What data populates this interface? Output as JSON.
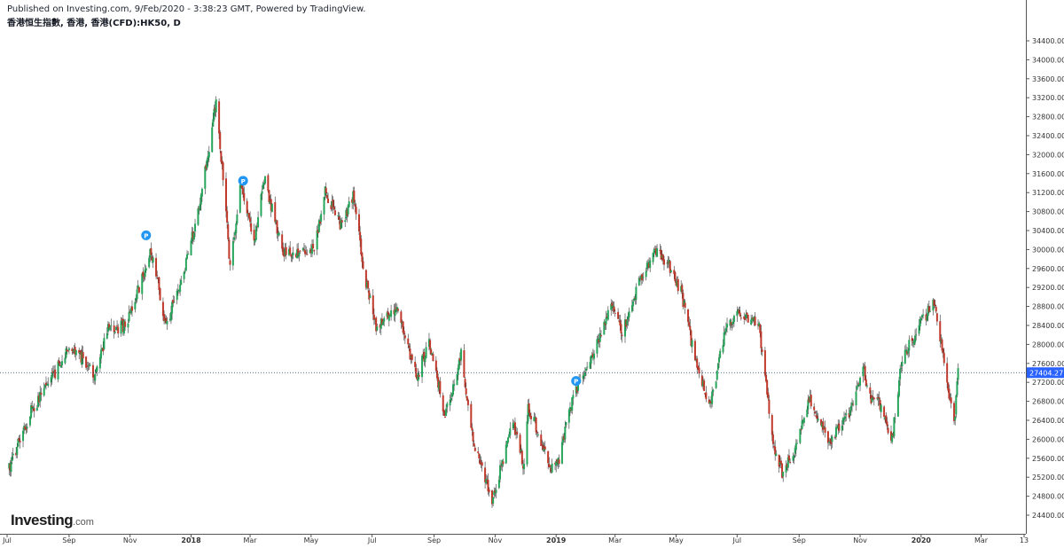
{
  "header": {
    "published": "Published on Investing.com, 9/Feb/2020 - 3:38:23 GMT, Powered by TradingView.",
    "symbol": "香港恒生指數, 香港, 香港(CFD):HK50, D"
  },
  "brand": {
    "name": "Investing",
    "suffix": ".com"
  },
  "colors": {
    "up": "#26a65b",
    "down": "#c0392b",
    "wick": "#333333",
    "current_price_bg": "#2962ff",
    "marker": "#2196f3"
  },
  "chart_data": {
    "type": "candlestick",
    "grid": false,
    "y_range": [
      24200,
      34600
    ],
    "y_ticks": [
      "34400.00",
      "34000.00",
      "33600.00",
      "33200.00",
      "32800.00",
      "32400.00",
      "32000.00",
      "31600.00",
      "31200.00",
      "30800.00",
      "30400.00",
      "30000.00",
      "29600.00",
      "29200.00",
      "28800.00",
      "28400.00",
      "28000.00",
      "27600.00",
      "27200.00",
      "26800.00",
      "26400.00",
      "26000.00",
      "25600.00",
      "25200.00",
      "24800.00",
      "24400.00"
    ],
    "x_ticks": [
      {
        "label": "Jul",
        "date": "2017-07-01"
      },
      {
        "label": "Sep",
        "date": "2017-09-01"
      },
      {
        "label": "Nov",
        "date": "2017-11-01"
      },
      {
        "label": "2018",
        "date": "2018-01-01",
        "bold": true
      },
      {
        "label": "Mar",
        "date": "2018-03-01"
      },
      {
        "label": "May",
        "date": "2018-05-01"
      },
      {
        "label": "Jul",
        "date": "2018-07-01"
      },
      {
        "label": "Sep",
        "date": "2018-09-01"
      },
      {
        "label": "Nov",
        "date": "2018-11-01"
      },
      {
        "label": "2019",
        "date": "2019-01-01",
        "bold": true
      },
      {
        "label": "Mar",
        "date": "2019-03-01"
      },
      {
        "label": "May",
        "date": "2019-05-01"
      },
      {
        "label": "Jul",
        "date": "2019-07-01"
      },
      {
        "label": "Sep",
        "date": "2019-09-01"
      },
      {
        "label": "Nov",
        "date": "2019-11-01"
      },
      {
        "label": "2020",
        "date": "2020-01-01",
        "bold": true
      },
      {
        "label": "Mar",
        "date": "2020-03-01"
      },
      {
        "label": "13",
        "date": "2020-04-13"
      }
    ],
    "current_price": 27404.27,
    "current_price_label": "27404.27",
    "anchors": [
      {
        "date": "2017-07-03",
        "close": 25400
      },
      {
        "date": "2017-07-25",
        "close": 26600
      },
      {
        "date": "2017-08-10",
        "close": 27100
      },
      {
        "date": "2017-08-31",
        "close": 27900
      },
      {
        "date": "2017-09-15",
        "close": 27700
      },
      {
        "date": "2017-09-26",
        "close": 27400
      },
      {
        "date": "2017-10-10",
        "close": 28300
      },
      {
        "date": "2017-10-27",
        "close": 28400
      },
      {
        "date": "2017-11-10",
        "close": 29200
      },
      {
        "date": "2017-11-22",
        "close": 30000
      },
      {
        "date": "2017-12-07",
        "close": 28400
      },
      {
        "date": "2017-12-27",
        "close": 29700
      },
      {
        "date": "2018-01-10",
        "close": 31000
      },
      {
        "date": "2018-01-26",
        "close": 33100
      },
      {
        "date": "2018-02-06",
        "close": 30600
      },
      {
        "date": "2018-02-09",
        "close": 29600
      },
      {
        "date": "2018-02-20",
        "close": 31400
      },
      {
        "date": "2018-03-05",
        "close": 30100
      },
      {
        "date": "2018-03-15",
        "close": 31500
      },
      {
        "date": "2018-04-04",
        "close": 29900
      },
      {
        "date": "2018-05-04",
        "close": 30000
      },
      {
        "date": "2018-05-15",
        "close": 31200
      },
      {
        "date": "2018-05-31",
        "close": 30500
      },
      {
        "date": "2018-06-12",
        "close": 31100
      },
      {
        "date": "2018-06-25",
        "close": 29300
      },
      {
        "date": "2018-07-05",
        "close": 28300
      },
      {
        "date": "2018-07-25",
        "close": 28800
      },
      {
        "date": "2018-08-15",
        "close": 27300
      },
      {
        "date": "2018-08-27",
        "close": 28100
      },
      {
        "date": "2018-09-12",
        "close": 26500
      },
      {
        "date": "2018-09-28",
        "close": 27800
      },
      {
        "date": "2018-10-11",
        "close": 25900
      },
      {
        "date": "2018-10-30",
        "close": 24700
      },
      {
        "date": "2018-11-09",
        "close": 25600
      },
      {
        "date": "2018-11-19",
        "close": 26400
      },
      {
        "date": "2018-11-30",
        "close": 25400
      },
      {
        "date": "2018-12-04",
        "close": 26700
      },
      {
        "date": "2018-12-20",
        "close": 25800
      },
      {
        "date": "2018-12-27",
        "close": 25400
      },
      {
        "date": "2019-01-04",
        "close": 25600
      },
      {
        "date": "2019-01-18",
        "close": 26900
      },
      {
        "date": "2019-02-08",
        "close": 27900
      },
      {
        "date": "2019-02-26",
        "close": 28800
      },
      {
        "date": "2019-03-08",
        "close": 28200
      },
      {
        "date": "2019-03-21",
        "close": 29100
      },
      {
        "date": "2019-04-10",
        "close": 30000
      },
      {
        "date": "2019-04-26",
        "close": 29600
      },
      {
        "date": "2019-05-06",
        "close": 29100
      },
      {
        "date": "2019-05-20",
        "close": 27700
      },
      {
        "date": "2019-06-04",
        "close": 26700
      },
      {
        "date": "2019-06-20",
        "close": 28400
      },
      {
        "date": "2019-07-04",
        "close": 28700
      },
      {
        "date": "2019-07-23",
        "close": 28400
      },
      {
        "date": "2019-08-06",
        "close": 25900
      },
      {
        "date": "2019-08-15",
        "close": 25300
      },
      {
        "date": "2019-08-26",
        "close": 25700
      },
      {
        "date": "2019-09-11",
        "close": 26900
      },
      {
        "date": "2019-10-02",
        "close": 25900
      },
      {
        "date": "2019-10-11",
        "close": 26300
      },
      {
        "date": "2019-10-25",
        "close": 26700
      },
      {
        "date": "2019-11-04",
        "close": 27500
      },
      {
        "date": "2019-11-12",
        "close": 26800
      },
      {
        "date": "2019-11-20",
        "close": 26800
      },
      {
        "date": "2019-12-03",
        "close": 26000
      },
      {
        "date": "2019-12-13",
        "close": 27700
      },
      {
        "date": "2020-01-02",
        "close": 28500
      },
      {
        "date": "2020-01-14",
        "close": 28900
      },
      {
        "date": "2020-01-22",
        "close": 27900
      },
      {
        "date": "2020-02-03",
        "close": 26300
      },
      {
        "date": "2020-02-07",
        "close": 27404
      }
    ],
    "markers": [
      {
        "date": "2017-11-17",
        "price": 30300,
        "label": "P"
      },
      {
        "date": "2018-02-22",
        "price": 31450,
        "label": "P"
      },
      {
        "date": "2019-01-21",
        "price": 27230,
        "label": "P"
      }
    ]
  }
}
